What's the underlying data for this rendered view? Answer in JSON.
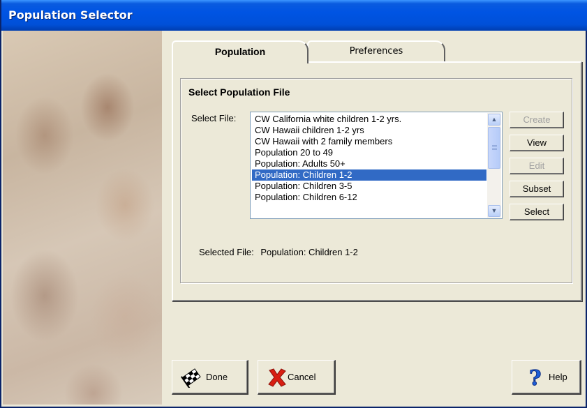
{
  "window": {
    "title": "Population Selector"
  },
  "tabs": [
    {
      "label": "Population",
      "active": true
    },
    {
      "label": "Preferences",
      "active": false
    }
  ],
  "group": {
    "title": "Select Population File"
  },
  "file_select": {
    "label": "Select File:",
    "items": [
      "CW California white children 1-2 yrs.",
      "CW Hawaii children 1-2 yrs",
      "CW Hawaii with 2 family members",
      "Population 20 to 49",
      "Population: Adults 50+",
      "Population: Children 1-2",
      "Population: Children 3-5",
      "Population: Children 6-12"
    ],
    "selected_index": 5
  },
  "side_buttons": {
    "create": "Create",
    "view": "View",
    "edit": "Edit",
    "subset": "Subset",
    "select": "Select"
  },
  "selected_file": {
    "label": "Selected File:",
    "value": "Population: Children 1-2"
  },
  "bottom_buttons": {
    "done": "Done",
    "cancel": "Cancel",
    "help": "Help"
  },
  "colors": {
    "titlebar": "#0054E3",
    "selection": "#316AC5",
    "window_bg": "#ECE9D8"
  }
}
